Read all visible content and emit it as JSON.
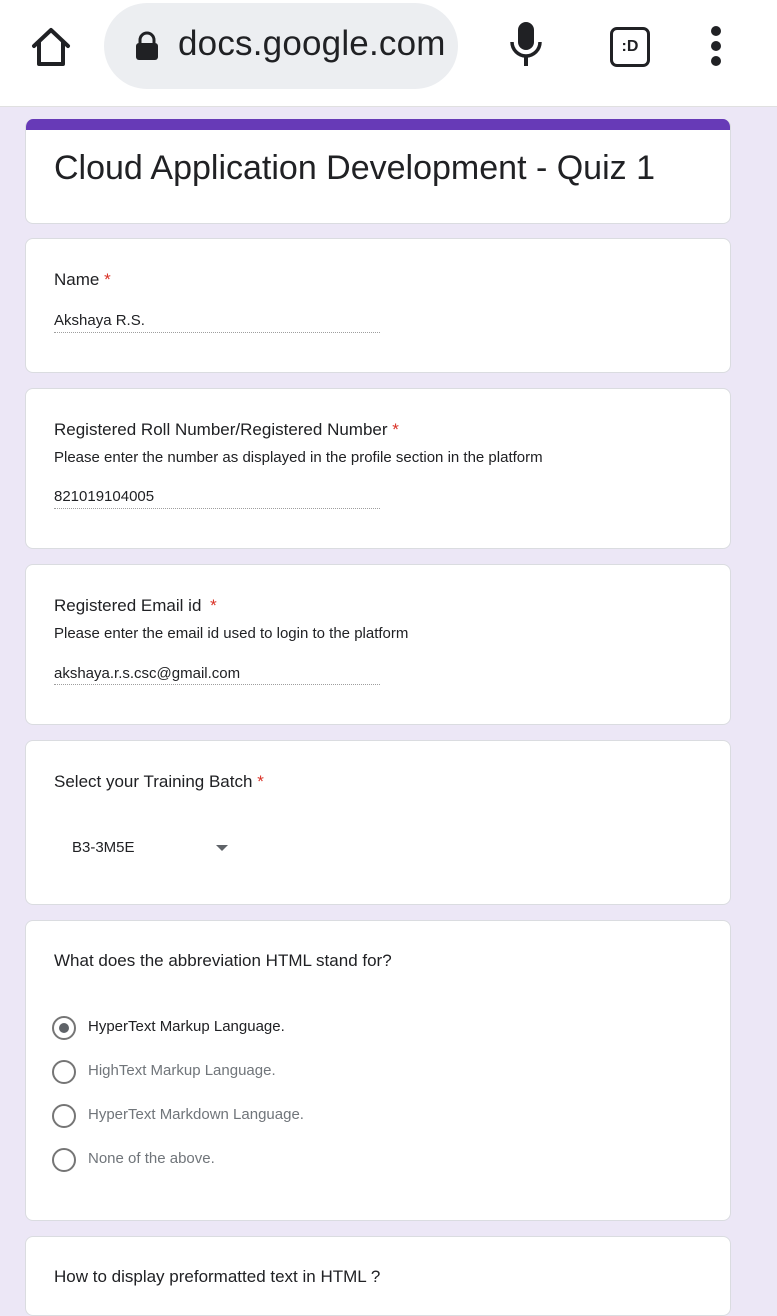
{
  "browser": {
    "url": "docs.google.com",
    "tabs_label": ":D"
  },
  "form": {
    "title": "Cloud Application Development - Quiz 1",
    "required_mark": "*",
    "questions": [
      {
        "title": "Name",
        "answer": "Akshaya R.S."
      },
      {
        "title": "Registered Roll Number/Registered Number",
        "description": "Please enter the number as displayed in the profile section in the platform",
        "answer": "821019104005"
      },
      {
        "title": "Registered Email id",
        "description": "Please enter the email id used to login to the platform",
        "answer": "akshaya.r.s.csc@gmail.com"
      },
      {
        "title": "Select your Training Batch",
        "selected": "B3-3M5E"
      },
      {
        "title": "What does the abbreviation HTML stand for?",
        "options": [
          "HyperText Markup Language.",
          "HighText Markup Language.",
          "HyperText Markdown Language.",
          "None of the above."
        ],
        "selected_index": 0
      },
      {
        "title": "How to display preformatted text in HTML ?"
      }
    ]
  }
}
